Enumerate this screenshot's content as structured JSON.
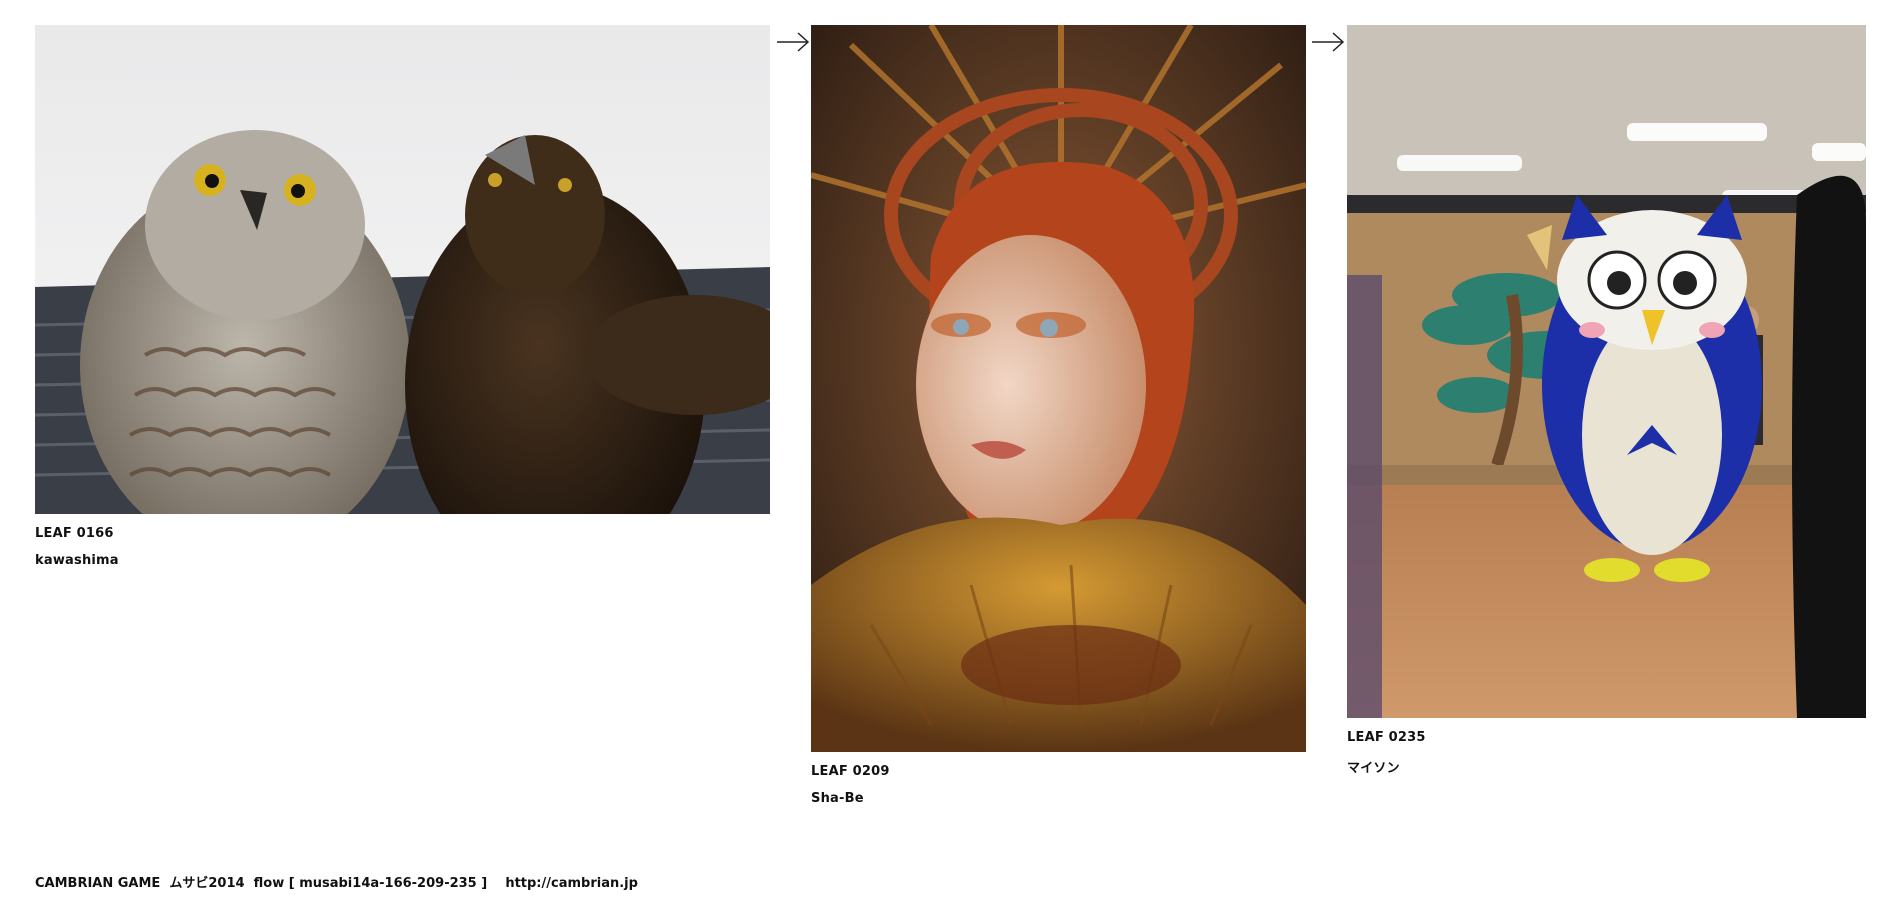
{
  "leaves": [
    {
      "id": "LEAF 0166",
      "author": "kawashima",
      "image": "owl-and-eagle-photo"
    },
    {
      "id": "LEAF 0209",
      "author": "Sha-Be",
      "image": "feather-headdress-portrait-photo"
    },
    {
      "id": "LEAF 0235",
      "author": "マイソン",
      "image": "owl-mascot-costume-photo"
    }
  ],
  "arrows": [
    "arrow-right-icon",
    "arrow-right-icon"
  ],
  "footer": {
    "project": "CAMBRIAN GAME",
    "event": "ムサビ2014",
    "flow": "flow [ musabi14a-166-209-235 ]",
    "url": "http://cambrian.jp"
  }
}
